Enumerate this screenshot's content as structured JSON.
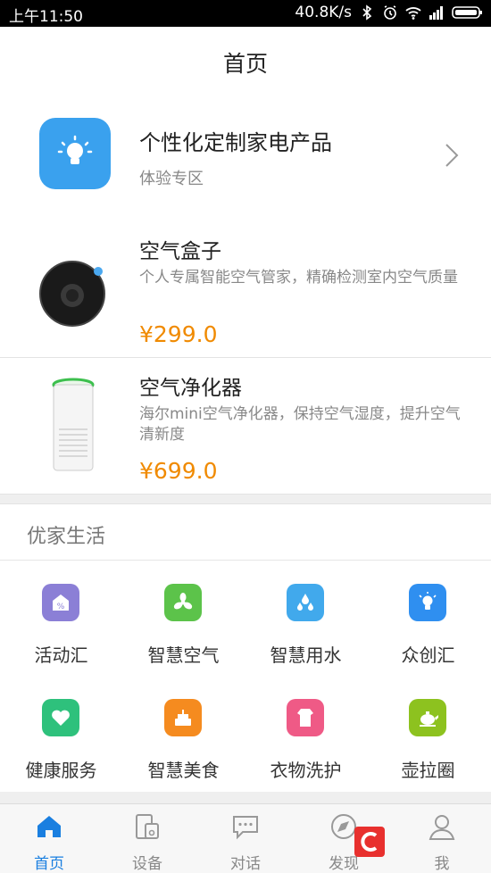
{
  "status_bar": {
    "time": "上午11:50",
    "speed": "40.8K/s"
  },
  "header": {
    "title": "首页"
  },
  "promo": {
    "title": "个性化定制家电产品",
    "subtitle": "体验专区",
    "icon": "lightbulb-icon"
  },
  "products": [
    {
      "name": "空气盒子",
      "desc": "个人专属智能空气管家，精确检测室内空气质量",
      "price": "¥299.0"
    },
    {
      "name": "空气净化器",
      "desc": "海尔mini空气净化器，保持空气湿度，提升空气清新度",
      "price": "¥699.0"
    }
  ],
  "section": {
    "title": "优家生活",
    "items": [
      {
        "label": "活动汇",
        "icon": "activity-icon",
        "color": "#8b7fd6"
      },
      {
        "label": "智慧空气",
        "icon": "fan-icon",
        "color": "#5cc34a"
      },
      {
        "label": "智慧用水",
        "icon": "water-drops-icon",
        "color": "#41a9ec"
      },
      {
        "label": "众创汇",
        "icon": "lightbulb-icon",
        "color": "#2f8ff0"
      },
      {
        "label": "健康服务",
        "icon": "heart-icon",
        "color": "#2ec17c"
      },
      {
        "label": "智慧美食",
        "icon": "cake-icon",
        "color": "#f58b1f"
      },
      {
        "label": "衣物洗护",
        "icon": "shirt-icon",
        "color": "#ef5a86"
      },
      {
        "label": "壶拉圈",
        "icon": "teapot-icon",
        "color": "#8dc21f"
      }
    ]
  },
  "tabs": [
    {
      "label": "首页",
      "icon": "home-icon",
      "active": true
    },
    {
      "label": "设备",
      "icon": "device-icon"
    },
    {
      "label": "对话",
      "icon": "chat-icon"
    },
    {
      "label": "发现",
      "icon": "compass-icon"
    },
    {
      "label": "我",
      "icon": "user-icon"
    }
  ],
  "colors": {
    "accent": "#1a7fe0",
    "price": "#f08a00",
    "promo_icon_bg": "#3aa1ee"
  }
}
